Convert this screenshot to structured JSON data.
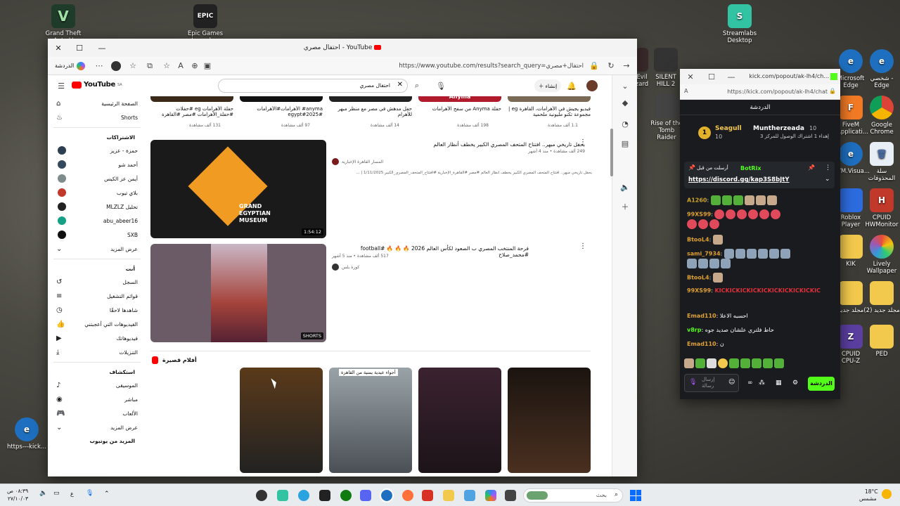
{
  "desktop": {
    "icons": [
      {
        "label": "Grand Theft Auto V",
        "short": "V",
        "color": "#1f3b2a"
      },
      {
        "label": "Epic Games Launcher",
        "short": "EPIC",
        "color": "#222"
      },
      {
        "label": "Streamlabs Desktop",
        "short": "S",
        "color": "#31c3a2"
      },
      {
        "label": "https---kick...",
        "short": "e",
        "color": "#1e6fbf"
      },
      {
        "label": "SILENT HILL 2",
        "short": "",
        "color": "#333"
      },
      {
        "label": "Rise of the Tomb Raider",
        "short": "",
        "color": "#444"
      },
      {
        "label": "Microsoft Edge",
        "short": "e",
        "color": "#1e6fbf"
      },
      {
        "label": "شخصي - Edge",
        "short": "e",
        "color": "#1e6fbf"
      },
      {
        "label": "Google Chrome",
        "short": "",
        "color": "#e0e0e0"
      },
      {
        "label": "FiveM Applicati...",
        "short": "F",
        "color": "#f27a24"
      },
      {
        "label": "سلة المحذوفات",
        "short": "🗑",
        "color": "#e8eef5"
      },
      {
        "label": "VM.Visua...",
        "short": "e",
        "color": "#1e6fbf"
      },
      {
        "label": "CPUID HWMonitor",
        "short": "H",
        "color": "#c0392b"
      },
      {
        "label": "Roblox Player",
        "short": "",
        "color": "#2d6cdf"
      },
      {
        "label": "Lively Wallpaper",
        "short": "",
        "color": "#7b3fe4"
      },
      {
        "label": "KIK",
        "short": "",
        "color": "#f2c94c"
      },
      {
        "label": "مجلد جديد",
        "short": "",
        "color": "#f2c94c"
      },
      {
        "label": "مجلد جديد (2)",
        "short": "",
        "color": "#f2c94c"
      },
      {
        "label": "CPUID CPU-Z",
        "short": "Z",
        "color": "#5b3fa0"
      },
      {
        "label": "PED",
        "short": "",
        "color": "#f2c94c"
      },
      {
        "label": "Evil zard",
        "short": "",
        "color": "#3a2b2b"
      }
    ]
  },
  "browser": {
    "title": "احتفال مصري - YouTube",
    "url": "https://www.youtube.com/results?search_query=احتفال+مصري",
    "chat_label": "الدردشة"
  },
  "youtube": {
    "logo": "YouTube",
    "logo_sup": "SA",
    "search_value": "احتفال مصري",
    "create_label": "إنشاء",
    "side": {
      "home": "الصفحة الرئيسية",
      "shorts": "Shorts",
      "subs": "الاشتراكات",
      "channels": [
        "حمزة - عزيز",
        "أحمد شو",
        "أيمن عز الكيس",
        "بلاي تيوب",
        "MLZLZ تحليل",
        "abu_abeer16",
        "SXB"
      ],
      "more": "عرض المزيد",
      "you": "أنت",
      "you_items": [
        "السجل",
        "قوائم التشغيل",
        "شاهدها لاحقًا",
        "الفيديوهات التي أعجبتني",
        "فيديوهاتك",
        "التنزيلات"
      ],
      "explore": "استكشاف",
      "explore_items": [
        "الموسيقى",
        "مباشر",
        "الألعاب",
        "عرض المزيد"
      ],
      "more_yt": "المزيد من يوتيوب"
    },
    "top_row": [
      {
        "title": "حفلة الأهرامات eg #حفلات #حفلة_الأهرامات #مصر #القاهرة",
        "meta": "131 ألف مشاهدة"
      },
      {
        "title": "anyma# الأهرامات#الأهرامات #egypt#2025",
        "meta": "97 ألف مشاهدة"
      },
      {
        "title": "حفل مدهش في مصر مع منظر مبهر للأهرام",
        "meta": "14 ألف مشاهدة"
      },
      {
        "title": "حفلة Anyma من سفح الأهرامات",
        "meta": "198 ألف مشاهدة"
      },
      {
        "title": "فيديو يجيش في الأهرامات، القاهرة eg | مجموعة تكنو مليونية ملحمية",
        "meta": "1.1 ألف مشاهدة"
      }
    ],
    "videos": [
      {
        "title": "بحفل تاريخي مبهر.. افتتاح المتحف المصري الكبير يخطف أنظار العالم",
        "meta": "249 ألف مشاهدة • منذ 4 أشهر",
        "channel": "المسار القاهرة الإخبارية",
        "desc": "بحفل تاريخي مبهر.. افتتاح المتحف المصري الكبير يخطف أنظار العالم #مصر #القاهرة_الإخبارية #افتتاح_المتحف_المصري_الكبير 1/11/2025 | ...",
        "duration": "1:54:12",
        "thumb_text": "GRAND EGYPTIAN MUSEUM"
      },
      {
        "title": "فرحة المنتخب المصري ب الصعود لكأس العالم 2026 🔥 🔥 🔥 #football #محمد_صلاح",
        "meta": "517 ألف مشاهدة • منذ 5 أشهر",
        "channel": "كورة بلس",
        "duration": "SHORTS"
      }
    ],
    "shorts_header": "أفلام قصيرة",
    "shorts": [
      {
        "title": ""
      },
      {
        "title": "أجواء عيدية يمنية من القاهرة"
      },
      {
        "title": ""
      },
      {
        "title": ""
      }
    ]
  },
  "kick": {
    "url": "https://kick.com/popout/ak-lh4/chat",
    "url_full": "kick.com/popout/ak-lh4/ch...",
    "header": "الدردشة",
    "gift_user": "Seagull",
    "gift_count": "10",
    "gift_to": "Muntherzeada",
    "gift_to_count": "10",
    "gift_text": "إهداء 1 اشتراك الوصول للمركز 3",
    "pinned_label": "أرسلت من قبل",
    "pinned_user": "BotRix",
    "pinned_link": "https://discord.gg/kap3S8bJtY",
    "messages": [
      {
        "user": "A1260",
        "text": ""
      },
      {
        "user": "99XS99",
        "text": ""
      },
      {
        "user": "BtooL4",
        "text": ""
      },
      {
        "user": "sami_7934",
        "text": ""
      },
      {
        "user": "BtooL4",
        "text": ""
      },
      {
        "user": "99XS99",
        "text": "KICKICKICKICKICKICKICKICKICKIC"
      },
      {
        "user": "Emad110",
        "text": "احسبه الاعلا"
      },
      {
        "user": "v8rp",
        "text": "حاط فلتري علشان صديد جوه"
      },
      {
        "user": "Emad110",
        "text": "ن"
      }
    ],
    "input_placeholder": "إرسال رسالة",
    "send_label": "الدردشة"
  },
  "taskbar": {
    "weather_temp": "18°C",
    "weather_desc": "مشمس",
    "time": "٠٨:٣٩ ص",
    "date": "٢٧/١٠/٠٣",
    "search": "بحث",
    "lang": "ع"
  }
}
